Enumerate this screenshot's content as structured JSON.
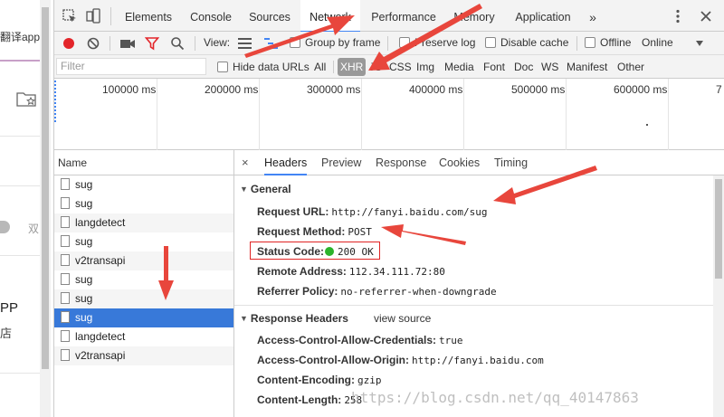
{
  "page": {
    "top_text": "翻译app",
    "side_glyph": "双",
    "app_text": "PP",
    "store_text": "店"
  },
  "tabs": [
    "Elements",
    "Console",
    "Sources",
    "Network",
    "Performance",
    "Memory",
    "Application"
  ],
  "active_tab": "Network",
  "more_tabs": "»",
  "toolbar": {
    "view_label": "View:",
    "group_by_frame": "Group by frame",
    "preserve_log": "Preserve log",
    "disable_cache": "Disable cache",
    "offline": "Offline",
    "online": "Online"
  },
  "filter": {
    "placeholder": "Filter",
    "hide_data_urls": "Hide data URLs",
    "types": [
      "All",
      "XHR",
      "JS",
      "CSS",
      "Img",
      "Media",
      "Font",
      "Doc",
      "WS",
      "Manifest",
      "Other"
    ],
    "active_type": "XHR"
  },
  "timeline": {
    "ticks": [
      "100000 ms",
      "200000 ms",
      "300000 ms",
      "400000 ms",
      "500000 ms",
      "600000 ms",
      "7"
    ]
  },
  "requests": {
    "header": "Name",
    "items": [
      "sug",
      "sug",
      "langdetect",
      "sug",
      "v2transapi",
      "sug",
      "sug",
      "sug",
      "langdetect",
      "v2transapi"
    ],
    "selected_index": 7
  },
  "detail_tabs": {
    "close": "×",
    "items": [
      "Headers",
      "Preview",
      "Response",
      "Cookies",
      "Timing"
    ],
    "active": "Headers"
  },
  "general": {
    "title": "General",
    "fields": [
      {
        "key": "Request URL:",
        "value": "http://fanyi.baidu.com/sug"
      },
      {
        "key": "Request Method:",
        "value": "POST"
      },
      {
        "key": "Status Code:",
        "value": "200  OK"
      },
      {
        "key": "Remote Address:",
        "value": "112.34.111.72:80"
      },
      {
        "key": "Referrer Policy:",
        "value": "no-referrer-when-downgrade"
      }
    ]
  },
  "response_headers": {
    "title": "Response Headers",
    "extra": "view source",
    "fields": [
      {
        "key": "Access-Control-Allow-Credentials:",
        "value": "true"
      },
      {
        "key": "Access-Control-Allow-Origin:",
        "value": "http://fanyi.baidu.com"
      },
      {
        "key": "Content-Encoding:",
        "value": "gzip"
      },
      {
        "key": "Content-Length:",
        "value": "258"
      }
    ]
  },
  "watermark": "https://blog.csdn.net/qq_40147863",
  "colors": {
    "accent": "#4285f4",
    "selected_row": "#3879d9",
    "record": "#e3252a",
    "filter_icon": "#e3252a",
    "annotation": "#e8463c",
    "status_ok": "#2bb32b"
  },
  "icons": [
    "inspect-icon",
    "device-icon",
    "kebab-icon",
    "close-icon",
    "record-icon",
    "clear-icon",
    "camera-icon",
    "filter-icon",
    "search-icon",
    "large-rows-icon",
    "waterfall-icon",
    "throttle-dropdown-icon"
  ]
}
